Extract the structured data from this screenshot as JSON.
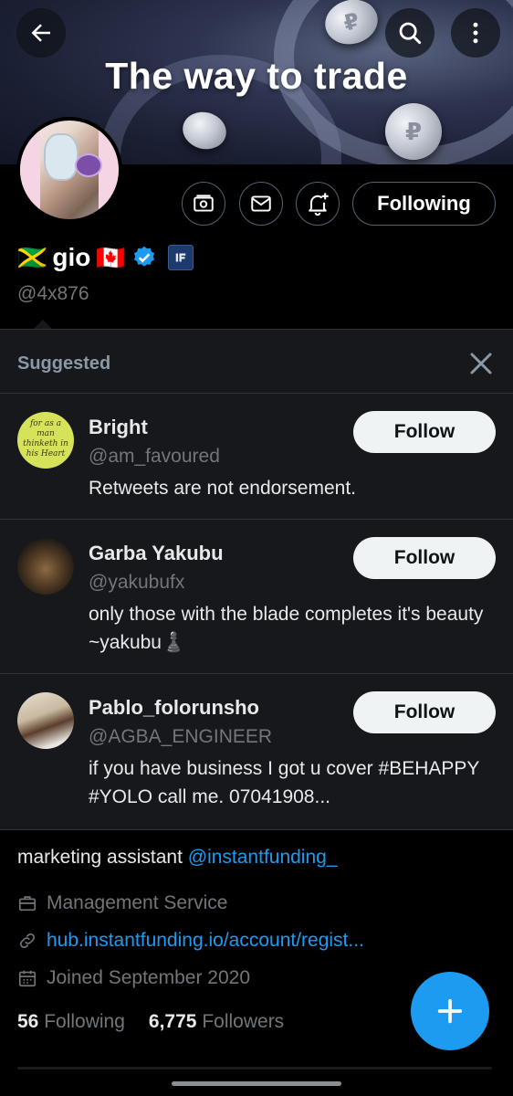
{
  "header": {
    "banner_text": "The way to trade",
    "back_icon": "arrow-left-icon",
    "search_icon": "search-icon",
    "more_icon": "more-vertical-icon"
  },
  "profile": {
    "name": "gio",
    "flag_left": "🇯🇲",
    "flag_right": "🇨🇦",
    "handle": "@4x876",
    "following_label": "Following",
    "verified_color": "#1d9bf0"
  },
  "suggested": {
    "title": "Suggested",
    "items": [
      {
        "name": "Bright",
        "handle": "@am_favoured",
        "bio": "Retweets are not endorsement.",
        "follow_label": "Follow",
        "avatar_text": "for as a man thinketh in his Heart"
      },
      {
        "name": "Garba Yakubu",
        "handle": "@yakubufx",
        "bio": "only those with the blade completes it's beauty  ~yakubu♟️",
        "follow_label": "Follow"
      },
      {
        "name": "Pablo_folorunsho",
        "handle": "@AGBA_ENGINEER",
        "bio": "if you have business I got u cover #BEHAPPY  #YOLO  call me.  07041908...",
        "follow_label": "Follow"
      }
    ]
  },
  "bio": {
    "text": "marketing assistant ",
    "mention": "@instantfunding_",
    "category": "Management Service",
    "link": "hub.instantfunding.io/account/regist...",
    "joined": "Joined September 2020"
  },
  "counts": {
    "following_count": "56",
    "following_label": "Following",
    "followers_count": "6,775",
    "followers_label": "Followers"
  },
  "colors": {
    "accent": "#1d9bf0",
    "background": "#000000",
    "panel": "#16181c"
  }
}
